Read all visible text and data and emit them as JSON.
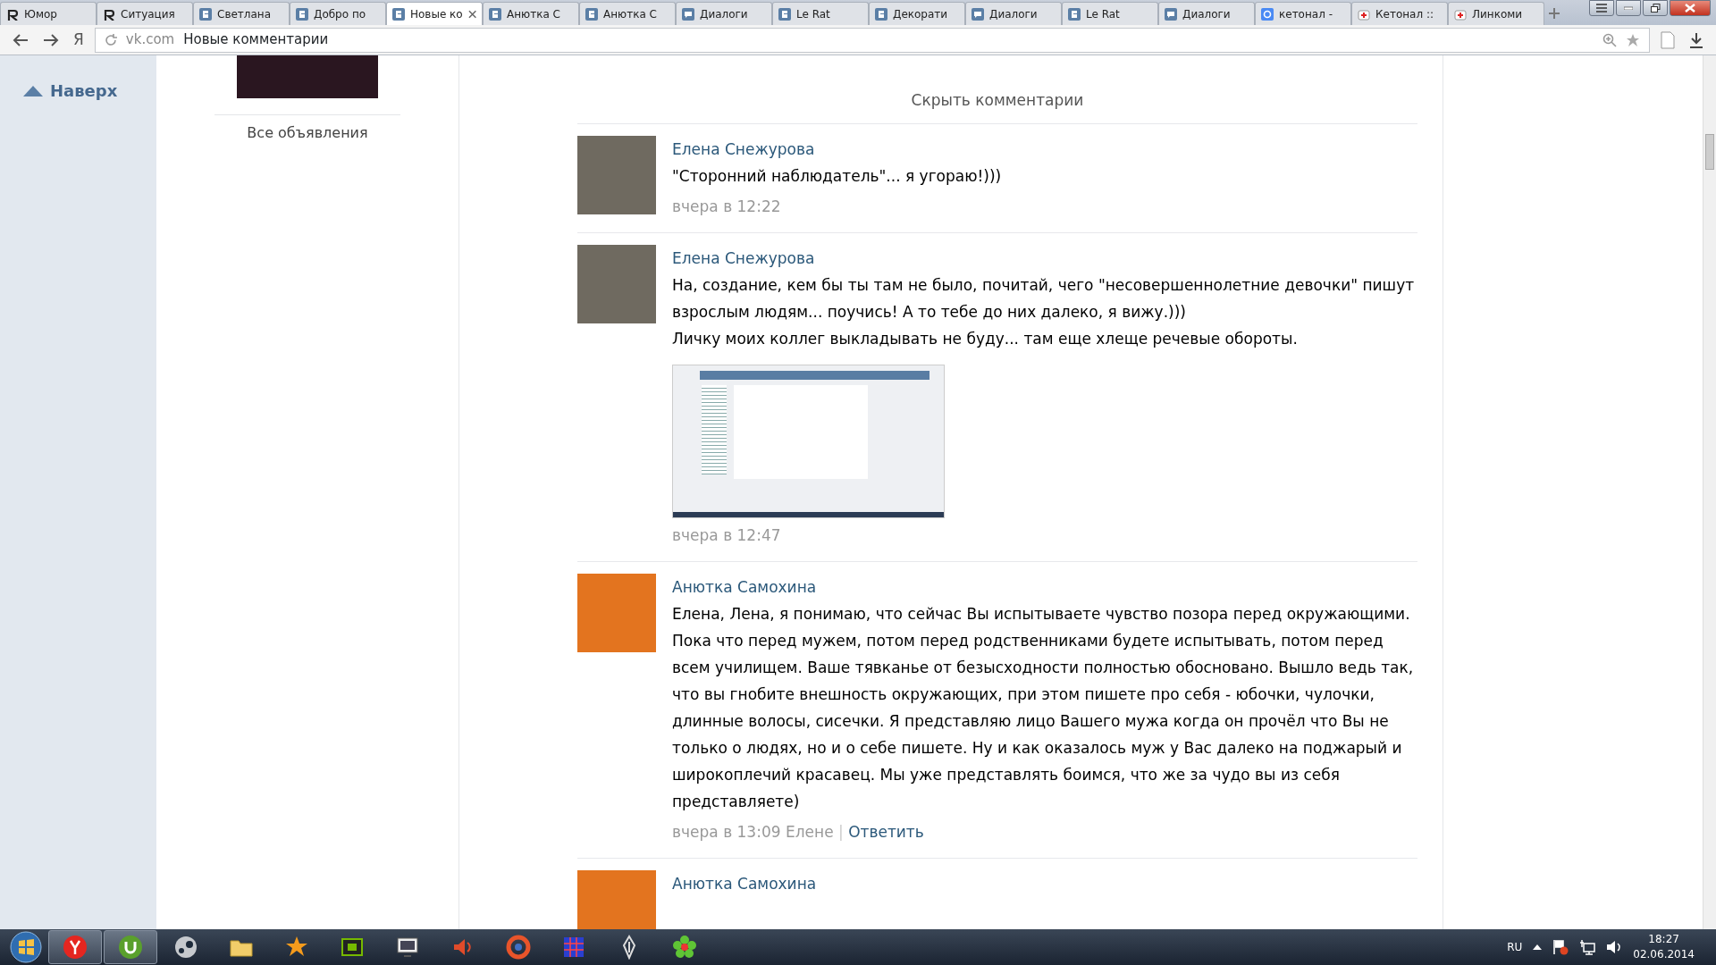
{
  "tabs": [
    {
      "label": "Юмор",
      "kind": "humor",
      "selected": false
    },
    {
      "label": "Ситуация",
      "kind": "humor",
      "selected": false
    },
    {
      "label": "Светлана",
      "kind": "vk",
      "selected": false
    },
    {
      "label": "Добро по",
      "kind": "vk",
      "selected": false
    },
    {
      "label": "Новые ко",
      "kind": "vk",
      "selected": true
    },
    {
      "label": "Анютка С",
      "kind": "vk",
      "selected": false
    },
    {
      "label": "Анютка С",
      "kind": "vk",
      "selected": false
    },
    {
      "label": "Диалоги",
      "kind": "dialog",
      "selected": false
    },
    {
      "label": "Le Rat",
      "kind": "vk",
      "selected": false
    },
    {
      "label": "Декорати",
      "kind": "vk",
      "selected": false
    },
    {
      "label": "Диалоги",
      "kind": "dialog",
      "selected": false
    },
    {
      "label": "Le Rat",
      "kind": "vk",
      "selected": false
    },
    {
      "label": "Диалоги",
      "kind": "dialog",
      "selected": false
    },
    {
      "label": "кетонал -",
      "kind": "google",
      "selected": false
    },
    {
      "label": "Кетонал ::",
      "kind": "medical",
      "selected": false
    },
    {
      "label": "Линкоми",
      "kind": "medical",
      "selected": false
    }
  ],
  "address_bar": {
    "yandex_button": "Я",
    "domain": "vk.com",
    "title": "Новые комментарии"
  },
  "sidebar": {
    "back_to_top": "Наверх"
  },
  "left_column": {
    "all_ads": "Все объявления"
  },
  "hide_comments": "Скрыть комментарии",
  "comments": [
    {
      "author": "Елена Снежурова",
      "avatar": {
        "kind": "photo"
      },
      "paragraphs": [
        "\"Сторонний наблюдатель\"... я угораю!)))"
      ],
      "time": "вчера в 12:22"
    },
    {
      "author": "Елена Снежурова",
      "avatar": {
        "kind": "photo"
      },
      "paragraphs": [
        "На, создание, кем бы ты там не было, почитай, чего \"несовершеннолетние девочки\" пишут взрослым людям... поучись! А то тебе до них далеко, я вижу.)))",
        "Личку моих коллег выкладывать не буду... там еще хлеще речевые обороты."
      ],
      "attachment": {
        "kind": "screenshot"
      },
      "time": "вчера в 12:47"
    },
    {
      "author": "Анютка Самохина",
      "avatar": {
        "kind": "cartoon"
      },
      "paragraphs": [
        "Елена, Лена, я понимаю, что сейчас Вы испытываете чувство позора перед окружающими. Пока что перед мужем, потом перед родственниками будете испытывать, потом перед всем училищем. Ваше тявканье от безысходности полностью обосновано. Вышло ведь так, что вы гнобите внешность окружающих, при этом пишете про себя - юбочки, чулочки, длинные волосы, сисечки. Я представляю лицо Вашего мужа когда он прочёл что Вы не только о людях, но и о себе пишете. Ну и как оказалось муж у Вас далеко на поджарый и широкоплечий красавец. Мы уже представлять боимся, что же за чудо вы из себя представляете)"
      ],
      "time": "вчера в 13:09",
      "reply_to": "Елене",
      "separator": "|",
      "reply": "Ответить"
    },
    {
      "author": "Анютка Самохина",
      "avatar": {
        "kind": "cartoon"
      }
    }
  ],
  "taskbar": {
    "apps": [
      {
        "kind": "y-circle",
        "open": true
      },
      {
        "kind": "u-circle",
        "open": true
      },
      {
        "kind": "steam",
        "open": false
      },
      {
        "kind": "folder",
        "open": false
      },
      {
        "kind": "star",
        "open": false
      },
      {
        "kind": "chip",
        "open": false
      },
      {
        "kind": "monitor",
        "open": false
      },
      {
        "kind": "speaker",
        "open": false
      },
      {
        "kind": "swirl",
        "open": false
      },
      {
        "kind": "grid",
        "open": false
      },
      {
        "kind": "emblem",
        "open": false
      },
      {
        "kind": "flower",
        "open": false
      }
    ],
    "language": "RU",
    "time": "18:27",
    "date": "02.06.2014"
  }
}
